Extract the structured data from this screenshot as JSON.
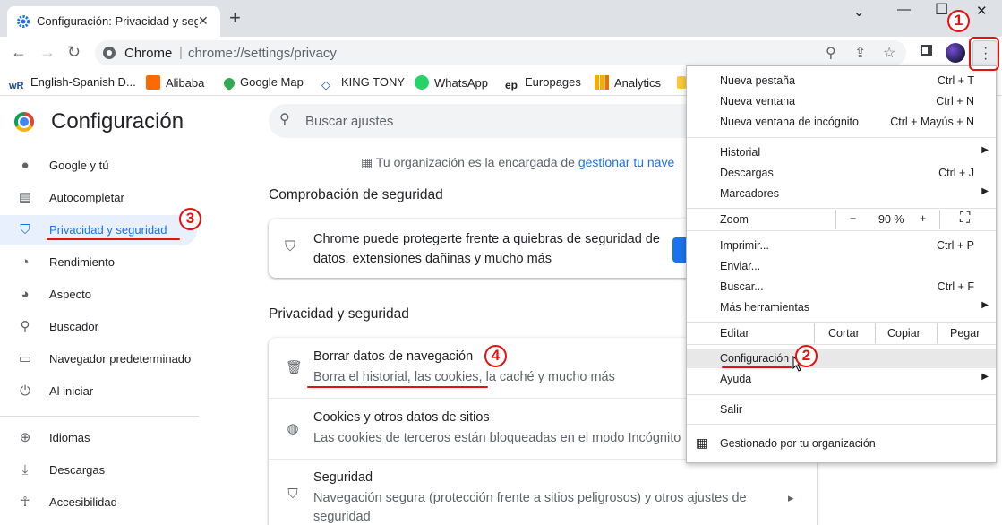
{
  "tab": {
    "title": "Configuración: Privacidad y seg",
    "close": "✕"
  },
  "new_tab": "+",
  "window": {
    "minimize": "⌄",
    "restore": "—",
    "maximize": "☐",
    "close": "✕"
  },
  "omnibox": {
    "site": "Chrome",
    "separator": "|",
    "url": "chrome://settings/privacy"
  },
  "bookmarks": [
    {
      "label": "English-Spanish D...",
      "icon": "wr-icon"
    },
    {
      "label": "Alibaba",
      "icon": "alibaba-icon"
    },
    {
      "label": "Google Map",
      "icon": "map-pin-icon"
    },
    {
      "label": "KING TONY",
      "icon": "kingtony-icon"
    },
    {
      "label": "WhatsApp",
      "icon": "whatsapp-icon"
    },
    {
      "label": "Europages",
      "icon": "europages-icon"
    },
    {
      "label": "Analytics",
      "icon": "analytics-icon"
    }
  ],
  "sidebar": {
    "title": "Configuración",
    "items": [
      {
        "label": "Google y tú",
        "icon": "person-icon"
      },
      {
        "label": "Autocompletar",
        "icon": "clipboard-icon"
      },
      {
        "label": "Privacidad y seguridad",
        "icon": "shield-icon",
        "active": true
      },
      {
        "label": "Rendimiento",
        "icon": "gauge-icon"
      },
      {
        "label": "Aspecto",
        "icon": "palette-icon"
      },
      {
        "label": "Buscador",
        "icon": "search-icon"
      },
      {
        "label": "Navegador predeterminado",
        "icon": "browser-icon"
      },
      {
        "label": "Al iniciar",
        "icon": "power-icon"
      },
      {
        "label": "Idiomas",
        "icon": "globe-icon"
      },
      {
        "label": "Descargas",
        "icon": "download-icon"
      },
      {
        "label": "Accesibilidad",
        "icon": "accessibility-icon"
      }
    ]
  },
  "search": {
    "placeholder": "Buscar ajustes"
  },
  "org_notice": {
    "text": "Tu organización es la encargada de ",
    "link": "gestionar tu nave"
  },
  "safety_check": {
    "heading": "Comprobación de seguridad",
    "line1": "Chrome puede protegerte frente a quiebras de seguridad de",
    "line2": "datos, extensiones dañinas y mucho más"
  },
  "privacy": {
    "heading": "Privacidad y seguridad",
    "rows": [
      {
        "title": "Borrar datos de navegación",
        "subtitle": "Borra el historial, las cookies, la caché y mucho más",
        "icon": "trash-icon"
      },
      {
        "title": "Cookies y otros datos de sitios",
        "subtitle": "Las cookies de terceros están bloqueadas en el modo Incógnito",
        "icon": "cookie-icon"
      },
      {
        "title": "Seguridad",
        "subtitle": "Navegación segura (protección frente a sitios peligrosos) y otros ajustes de",
        "subtitle2": "seguridad",
        "icon": "shield-icon"
      }
    ]
  },
  "menu": {
    "group1": [
      {
        "label": "Nueva pestaña",
        "shortcut": "Ctrl + T"
      },
      {
        "label": "Nueva ventana",
        "shortcut": "Ctrl + N"
      },
      {
        "label": "Nueva ventana de incógnito",
        "shortcut": "Ctrl + Mayús + N"
      }
    ],
    "group2": [
      {
        "label": "Historial"
      },
      {
        "label": "Descargas",
        "shortcut": "Ctrl + J"
      },
      {
        "label": "Marcadores"
      }
    ],
    "zoom": {
      "label": "Zoom",
      "minus": "−",
      "value": "90 %",
      "plus": "+",
      "fullscreen": "⛶"
    },
    "group3": [
      {
        "label": "Imprimir...",
        "shortcut": "Ctrl + P"
      },
      {
        "label": "Enviar..."
      },
      {
        "label": "Buscar...",
        "shortcut": "Ctrl + F"
      },
      {
        "label": "Más herramientas"
      }
    ],
    "edit": {
      "label": "Editar",
      "cut": "Cortar",
      "copy": "Copiar",
      "paste": "Pegar"
    },
    "group4": [
      {
        "label": "Configuración"
      },
      {
        "label": "Ayuda"
      }
    ],
    "exit": "Salir",
    "managed": "Gestionado por tu organización"
  },
  "annotations": {
    "a1": "1",
    "a2": "2",
    "a3": "3",
    "a4": "4"
  },
  "colors": {
    "accent": "#1a73e8",
    "annotation": "#e5110f"
  }
}
